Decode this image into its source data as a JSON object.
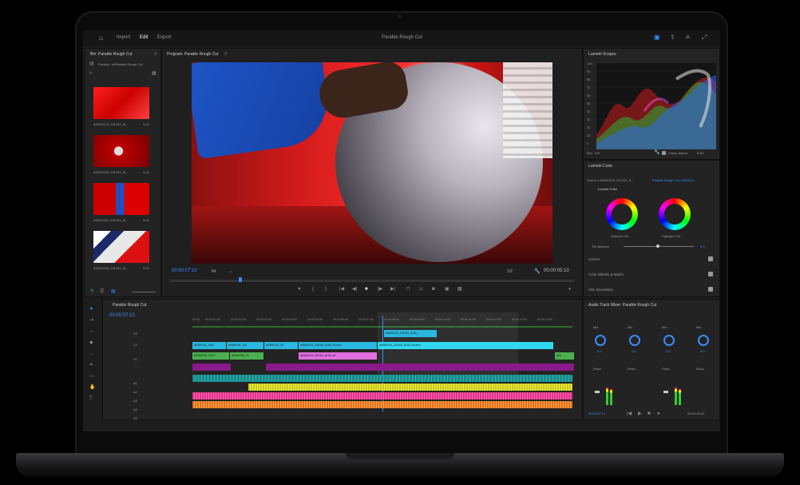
{
  "app": {
    "title": "Parable Rough Cut",
    "nav": [
      "Import",
      "Edit",
      "Export"
    ]
  },
  "bin": {
    "title": "Bin: Parable Rough Cut",
    "path": "Parable...nt/Parable Rough Cut",
    "clips": [
      {
        "name": "A005C013_231031_5L...",
        "duration": "4;29"
      },
      {
        "name": "A005C009_231031_5L...",
        "duration": "4;29"
      },
      {
        "name": "A005C007_231031_5L...",
        "duration": "4;29"
      },
      {
        "name": "A005C008_231031_5L...",
        "duration": "4;29"
      }
    ]
  },
  "program": {
    "title": "Program: Parable Rough Cut",
    "timecode": "00:00:07:10",
    "fit": "Fit",
    "resolution": "1/2",
    "duration": "00:00:05:10"
  },
  "timeline": {
    "title": "Parable Rough Cut",
    "timecode": "00:00:07:10",
    "ruler": [
      "00:00",
      "00:00:01:00",
      "00:00:02:00",
      "00:00:03:00",
      "00:00:04:00",
      "00:00:05:00",
      "00:00:06:00",
      "00:00:07:00",
      "00:00:08:00",
      "00:00:09:00",
      "00:00:10:00",
      "00:00:11:00",
      "00:00:12:00",
      "00:00:13:00",
      "00:00:14:00"
    ],
    "tracks": [
      "V3",
      "V2",
      "V1",
      "A1",
      "A2",
      "A3",
      "A4",
      "A5"
    ],
    "video_clips": {
      "v3": "A005C010_231031_5L92_...",
      "v2": [
        "A005C011_2310",
        "A005C011_231",
        "A005C012_23",
        "A005C014_231031_5L92_04.mov",
        "A005C010_231031_5L92_04.mov"
      ],
      "v1": [
        "A005C008_2310",
        "A005C009_23",
        "A005C013_231031_5L92_04",
        "A00"
      ]
    }
  },
  "lumetri_scopes": {
    "title": "Lumetri Scopes",
    "scale": [
      "100",
      "90",
      "80",
      "70",
      "60",
      "50",
      "40",
      "30",
      "20",
      "10",
      "0"
    ],
    "footer_left": "Rec. 709",
    "clamp": "Clamp Signal",
    "bit": "8 Bit"
  },
  "lumetri_color": {
    "title": "Lumetri Color",
    "source": "Source • A005C010_231031_5...",
    "target": "Parable Rough Cut • A005C0...",
    "section": "Lumetri Color",
    "wheels": [
      "Shadow Tint",
      "Highlight Tint"
    ],
    "tint_balance_label": "Tint Balance",
    "tint_balance_value": "0.0",
    "sections": [
      "Curves",
      "Color Wheels & Match",
      "HSL Secondary"
    ]
  },
  "audio_mixer": {
    "title": "Audio Track Mixer: Parable Rough Cut",
    "channels": [
      "Mix",
      "Mix",
      "Mix",
      "Mix"
    ],
    "read": [
      "Read",
      "Read",
      "Read",
      "Read"
    ],
    "knob_value": "0.0",
    "timecode": "00:00:07:10",
    "duration": "00:00:15:10"
  },
  "colors": {
    "accent": "#3b8cff",
    "clip_blue": "#2ab8e0",
    "clip_green": "#4caf50",
    "clip_pink": "#e070e0",
    "clip_purple": "#8a1a8a",
    "audio_teal": "#1d8a8a",
    "audio_yellow": "#d8d820",
    "audio_pink": "#e0308a"
  }
}
